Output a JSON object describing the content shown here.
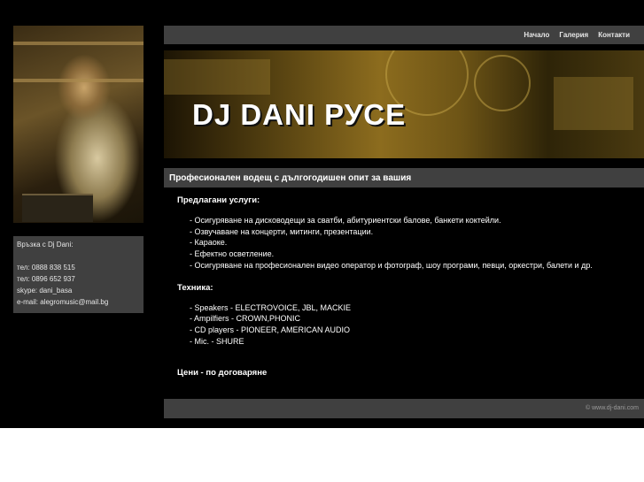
{
  "nav": {
    "items": [
      "Начало",
      "Галерия",
      "Контакти"
    ]
  },
  "banner": {
    "title": "DJ DANI РУСЕ"
  },
  "contact": {
    "heading": "Връзка с Dj Dani:",
    "phone1": "тел: 0888 838 515",
    "phone2": "тел: 0896 652 937",
    "skype": "skype: dani_basa",
    "email": "e-mail: alegromusic@mail.bg"
  },
  "subhead": "Професионален водещ с дългогодишен опит за вашия",
  "services": {
    "heading": "Предлагани услуги:",
    "items": [
      "- Осигуряване на дисководещи за сватби, абитуриентски балове, банкети коктейли.",
      "- Озвучаване на концерти, митинги, презентации.",
      "- Караоке.",
      "- Ефектно осветление.",
      "- Осигуряване на професионален видео оператор и фотограф, шоу програми, певци, оркестри, балети и др."
    ]
  },
  "equipment": {
    "heading": "Техника:",
    "items": [
      "- Speakers - ELECTROVOICE, JBL, MACKIE",
      "- Ampilfiers - CROWN,PHONIC",
      "- CD players - PIONEER, AMERICAN AUDIO",
      "- Mic. - SHURE"
    ]
  },
  "prices": "Цени - по договаряне",
  "footer": "© www.dj-dani.com",
  "colors": {
    "background": "#000000",
    "bar": "#404040",
    "text": "#ffffff"
  }
}
